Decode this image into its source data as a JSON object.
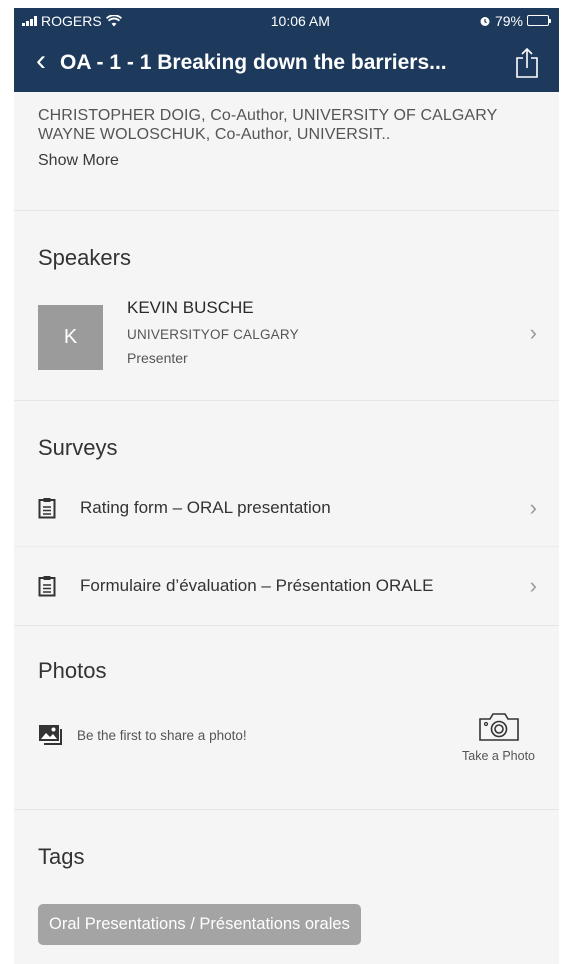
{
  "status_bar": {
    "carrier": "ROGERS",
    "time": "10:06 AM",
    "battery": "79%",
    "battery_level": 0.79
  },
  "nav": {
    "back_icon": "chevron-left-icon",
    "title": "OA - 1 - 1 Breaking down the barriers...",
    "share_icon": "share-icon"
  },
  "authors": {
    "text": "CHRISTOPHER DOIG, Co-Author, UNIVERSITY OF CALGARY WAYNE WOLOSCHUK, Co-Author, UNIVERSIT..",
    "show_more": "Show More"
  },
  "speakers": {
    "title": "Speakers",
    "items": [
      {
        "initial": "K",
        "name": "KEVIN BUSCHE",
        "org": "UNIVERSITYOF CALGARY",
        "role": "Presenter"
      }
    ]
  },
  "surveys": {
    "title": "Surveys",
    "items": [
      {
        "label": "Rating form – ORAL presentation",
        "icon": "clipboard-icon"
      },
      {
        "label": "Formulaire d’évaluation – Présentation ORALE",
        "icon": "clipboard-icon"
      }
    ]
  },
  "photos": {
    "title": "Photos",
    "empty_text": "Be the first to share a photo!",
    "take_photo": "Take a Photo"
  },
  "tags": {
    "title": "Tags",
    "items": [
      "Oral Presentations / Présentations orales"
    ]
  },
  "colors": {
    "header": "#1d3a5c",
    "background": "#f5f5f5",
    "avatar": "#9b9b9b",
    "tag_chip": "#a4a4a4"
  }
}
